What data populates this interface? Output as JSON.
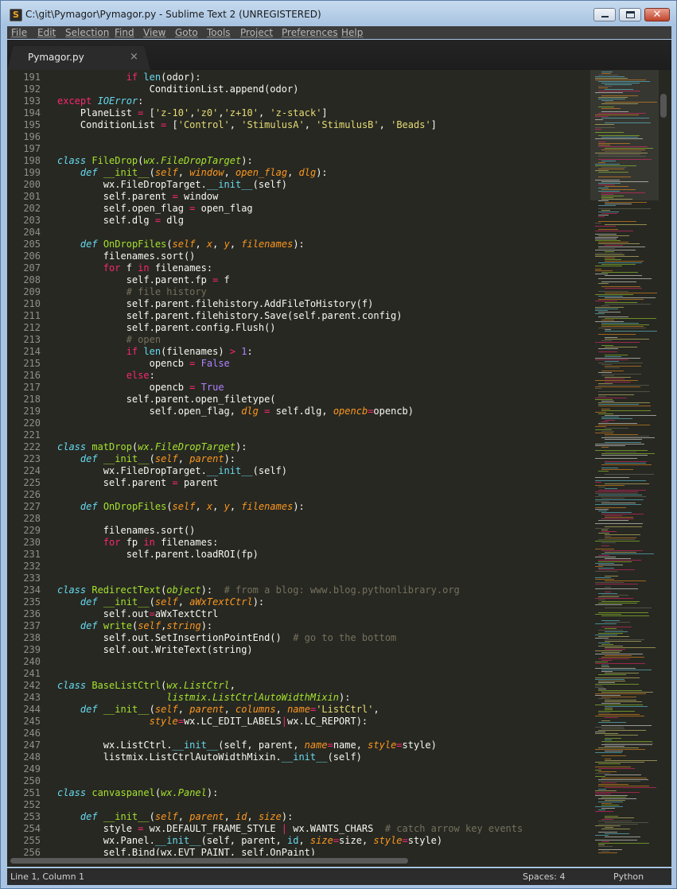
{
  "window": {
    "title": "C:\\git\\Pymagor\\Pymagor.py - Sublime Text 2 (UNREGISTERED)",
    "icon": "sublime-icon",
    "buttons": {
      "minimize": "minimize-icon",
      "maximize": "maximize-icon",
      "close": "close-icon"
    }
  },
  "menu": [
    "File",
    "Edit",
    "Selection",
    "Find",
    "View",
    "Goto",
    "Tools",
    "Project",
    "Preferences",
    "Help"
  ],
  "tab": {
    "label": "Pymagor.py",
    "close_glyph": "×"
  },
  "status": {
    "position": "Line 1, Column 1",
    "spaces": "Spaces: 4",
    "syntax": "Python"
  },
  "theme": {
    "background": "#272822",
    "foreground": "#f8f8f2",
    "keyword": "#f92672",
    "string": "#e6db74",
    "comment": "#75715e",
    "function": "#a6e22e",
    "builtin": "#66d9ef",
    "argument": "#fd971f",
    "number": "#ae81ff"
  },
  "editor": {
    "lines": [
      {
        "n": "191",
        "t": [
          [
            "            "
          ],
          [
            "if",
            "k"
          ],
          [
            " "
          ],
          [
            "len",
            "bi"
          ],
          [
            "(odor):"
          ]
        ]
      },
      {
        "n": "192",
        "t": [
          [
            "                ConditionList.append(odor)"
          ]
        ]
      },
      {
        "n": "193",
        "t": [
          [
            "except",
            "k"
          ],
          [
            " "
          ],
          [
            "IOError",
            "b"
          ],
          [
            ":"
          ]
        ]
      },
      {
        "n": "194",
        "t": [
          [
            "    PlaneList "
          ],
          [
            "=",
            "k"
          ],
          [
            " ["
          ],
          [
            "'z-10'",
            "s"
          ],
          [
            ","
          ],
          [
            "'z0'",
            "s"
          ],
          [
            ","
          ],
          [
            "'z+10'",
            "s"
          ],
          [
            ", "
          ],
          [
            "'z-stack'",
            "s"
          ],
          [
            "]"
          ]
        ]
      },
      {
        "n": "195",
        "t": [
          [
            "    ConditionList "
          ],
          [
            "=",
            "k"
          ],
          [
            " ["
          ],
          [
            "'Control'",
            "s"
          ],
          [
            ", "
          ],
          [
            "'StimulusA'",
            "s"
          ],
          [
            ", "
          ],
          [
            "'StimulusB'",
            "s"
          ],
          [
            ", "
          ],
          [
            "'Beads'",
            "s"
          ],
          [
            "]"
          ]
        ]
      },
      {
        "n": "196",
        "t": []
      },
      {
        "n": "197",
        "t": []
      },
      {
        "n": "198",
        "t": [
          [
            "class",
            "b"
          ],
          [
            " "
          ],
          [
            "FileDrop",
            "f"
          ],
          [
            "("
          ],
          [
            "wx.FileDropTarget",
            "i"
          ],
          [
            "):"
          ]
        ]
      },
      {
        "n": "199",
        "t": [
          [
            "    "
          ],
          [
            "def",
            "b"
          ],
          [
            " "
          ],
          [
            "__init__",
            "f"
          ],
          [
            "("
          ],
          [
            "self",
            "a"
          ],
          [
            ", "
          ],
          [
            "window",
            "a"
          ],
          [
            ", "
          ],
          [
            "open_flag",
            "a"
          ],
          [
            ", "
          ],
          [
            "dlg",
            "a"
          ],
          [
            "):"
          ]
        ]
      },
      {
        "n": "200",
        "t": [
          [
            "        wx.FileDropTarget."
          ],
          [
            "__init__",
            "bi"
          ],
          [
            "(self)"
          ]
        ]
      },
      {
        "n": "201",
        "t": [
          [
            "        self.parent "
          ],
          [
            "=",
            "k"
          ],
          [
            " window"
          ]
        ]
      },
      {
        "n": "202",
        "t": [
          [
            "        self.open_flag "
          ],
          [
            "=",
            "k"
          ],
          [
            " open_flag"
          ]
        ]
      },
      {
        "n": "203",
        "t": [
          [
            "        self.dlg "
          ],
          [
            "=",
            "k"
          ],
          [
            " dlg"
          ]
        ]
      },
      {
        "n": "204",
        "t": []
      },
      {
        "n": "205",
        "t": [
          [
            "    "
          ],
          [
            "def",
            "b"
          ],
          [
            " "
          ],
          [
            "OnDropFiles",
            "f"
          ],
          [
            "("
          ],
          [
            "self",
            "a"
          ],
          [
            ", "
          ],
          [
            "x",
            "a"
          ],
          [
            ", "
          ],
          [
            "y",
            "a"
          ],
          [
            ", "
          ],
          [
            "filenames",
            "a"
          ],
          [
            "):"
          ]
        ]
      },
      {
        "n": "206",
        "t": [
          [
            "        filenames.sort()"
          ]
        ]
      },
      {
        "n": "207",
        "t": [
          [
            "        "
          ],
          [
            "for",
            "k"
          ],
          [
            " f "
          ],
          [
            "in",
            "k"
          ],
          [
            " filenames:"
          ]
        ]
      },
      {
        "n": "208",
        "t": [
          [
            "            self.parent.fp "
          ],
          [
            "=",
            "k"
          ],
          [
            " f"
          ]
        ]
      },
      {
        "n": "209",
        "t": [
          [
            "            "
          ],
          [
            "# file history",
            "c"
          ]
        ]
      },
      {
        "n": "210",
        "t": [
          [
            "            self.parent.filehistory.AddFileToHistory(f)"
          ]
        ]
      },
      {
        "n": "211",
        "t": [
          [
            "            self.parent.filehistory.Save(self.parent.config)"
          ]
        ]
      },
      {
        "n": "212",
        "t": [
          [
            "            self.parent.config.Flush()"
          ]
        ]
      },
      {
        "n": "213",
        "t": [
          [
            "            "
          ],
          [
            "# open",
            "c"
          ]
        ]
      },
      {
        "n": "214",
        "t": [
          [
            "            "
          ],
          [
            "if",
            "k"
          ],
          [
            " "
          ],
          [
            "len",
            "bi"
          ],
          [
            "(filenames) "
          ],
          [
            ">",
            "k"
          ],
          [
            " "
          ],
          [
            "1",
            "n"
          ],
          [
            ":"
          ]
        ]
      },
      {
        "n": "215",
        "t": [
          [
            "                opencb "
          ],
          [
            "=",
            "k"
          ],
          [
            " "
          ],
          [
            "False",
            "n"
          ]
        ]
      },
      {
        "n": "216",
        "t": [
          [
            "            "
          ],
          [
            "else",
            "k"
          ],
          [
            ":"
          ]
        ]
      },
      {
        "n": "217",
        "t": [
          [
            "                opencb "
          ],
          [
            "=",
            "k"
          ],
          [
            " "
          ],
          [
            "True",
            "n"
          ]
        ]
      },
      {
        "n": "218",
        "t": [
          [
            "            self.parent.open_filetype("
          ]
        ]
      },
      {
        "n": "219",
        "t": [
          [
            "                self.open_flag, "
          ],
          [
            "dlg",
            "a"
          ],
          [
            " "
          ],
          [
            "=",
            "k"
          ],
          [
            " self.dlg, "
          ],
          [
            "opencb",
            "a"
          ],
          [
            "=",
            "k"
          ],
          [
            "opencb)"
          ]
        ]
      },
      {
        "n": "220",
        "t": []
      },
      {
        "n": "221",
        "t": []
      },
      {
        "n": "222",
        "t": [
          [
            "class",
            "b"
          ],
          [
            " "
          ],
          [
            "matDrop",
            "f"
          ],
          [
            "("
          ],
          [
            "wx.FileDropTarget",
            "i"
          ],
          [
            "):"
          ]
        ]
      },
      {
        "n": "223",
        "t": [
          [
            "    "
          ],
          [
            "def",
            "b"
          ],
          [
            " "
          ],
          [
            "__init__",
            "f"
          ],
          [
            "("
          ],
          [
            "self",
            "a"
          ],
          [
            ", "
          ],
          [
            "parent",
            "a"
          ],
          [
            "):"
          ]
        ]
      },
      {
        "n": "224",
        "t": [
          [
            "        wx.FileDropTarget."
          ],
          [
            "__init__",
            "bi"
          ],
          [
            "(self)"
          ]
        ]
      },
      {
        "n": "225",
        "t": [
          [
            "        self.parent "
          ],
          [
            "=",
            "k"
          ],
          [
            " parent"
          ]
        ]
      },
      {
        "n": "226",
        "t": []
      },
      {
        "n": "227",
        "t": [
          [
            "    "
          ],
          [
            "def",
            "b"
          ],
          [
            " "
          ],
          [
            "OnDropFiles",
            "f"
          ],
          [
            "("
          ],
          [
            "self",
            "a"
          ],
          [
            ", "
          ],
          [
            "x",
            "a"
          ],
          [
            ", "
          ],
          [
            "y",
            "a"
          ],
          [
            ", "
          ],
          [
            "filenames",
            "a"
          ],
          [
            "):"
          ]
        ]
      },
      {
        "n": "228",
        "t": []
      },
      {
        "n": "229",
        "t": [
          [
            "        filenames.sort()"
          ]
        ]
      },
      {
        "n": "230",
        "t": [
          [
            "        "
          ],
          [
            "for",
            "k"
          ],
          [
            " fp "
          ],
          [
            "in",
            "k"
          ],
          [
            " filenames:"
          ]
        ]
      },
      {
        "n": "231",
        "t": [
          [
            "            self.parent.loadROI(fp)"
          ]
        ]
      },
      {
        "n": "232",
        "t": []
      },
      {
        "n": "233",
        "t": []
      },
      {
        "n": "234",
        "t": [
          [
            "class",
            "b"
          ],
          [
            " "
          ],
          [
            "RedirectText",
            "f"
          ],
          [
            "("
          ],
          [
            "object",
            "i"
          ],
          [
            "):  "
          ],
          [
            "# from a blog: www.blog.pythonlibrary.org",
            "c"
          ]
        ]
      },
      {
        "n": "235",
        "t": [
          [
            "    "
          ],
          [
            "def",
            "b"
          ],
          [
            " "
          ],
          [
            "__init__",
            "f"
          ],
          [
            "("
          ],
          [
            "self",
            "a"
          ],
          [
            ", "
          ],
          [
            "aWxTextCtrl",
            "a"
          ],
          [
            "):"
          ]
        ]
      },
      {
        "n": "236",
        "t": [
          [
            "        self.out"
          ],
          [
            "=",
            "k"
          ],
          [
            "aWxTextCtrl"
          ]
        ]
      },
      {
        "n": "237",
        "t": [
          [
            "    "
          ],
          [
            "def",
            "b"
          ],
          [
            " "
          ],
          [
            "write",
            "f"
          ],
          [
            "("
          ],
          [
            "self",
            "a"
          ],
          [
            ","
          ],
          [
            "string",
            "a"
          ],
          [
            "):"
          ]
        ]
      },
      {
        "n": "238",
        "t": [
          [
            "        self.out.SetInsertionPointEnd()  "
          ],
          [
            "# go to the bottom",
            "c"
          ]
        ]
      },
      {
        "n": "239",
        "t": [
          [
            "        self.out.WriteText(string)"
          ]
        ]
      },
      {
        "n": "240",
        "t": []
      },
      {
        "n": "241",
        "t": []
      },
      {
        "n": "242",
        "t": [
          [
            "class",
            "b"
          ],
          [
            " "
          ],
          [
            "BaseListCtrl",
            "f"
          ],
          [
            "("
          ],
          [
            "wx.ListCtrl",
            "i"
          ],
          [
            ","
          ]
        ]
      },
      {
        "n": "243",
        "t": [
          [
            "                   "
          ],
          [
            "listmix.ListCtrlAutoWidthMixin",
            "i"
          ],
          [
            "):"
          ]
        ]
      },
      {
        "n": "244",
        "t": [
          [
            "    "
          ],
          [
            "def",
            "b"
          ],
          [
            " "
          ],
          [
            "__init__",
            "f"
          ],
          [
            "("
          ],
          [
            "self",
            "a"
          ],
          [
            ", "
          ],
          [
            "parent",
            "a"
          ],
          [
            ", "
          ],
          [
            "columns",
            "a"
          ],
          [
            ", "
          ],
          [
            "name",
            "a"
          ],
          [
            "=",
            "k"
          ],
          [
            "'ListCtrl'",
            "s"
          ],
          [
            ","
          ]
        ]
      },
      {
        "n": "245",
        "t": [
          [
            "                "
          ],
          [
            "style",
            "a"
          ],
          [
            "=",
            "k"
          ],
          [
            "wx.LC_EDIT_LABELS"
          ],
          [
            "|",
            "k"
          ],
          [
            "wx.LC_REPORT):"
          ]
        ]
      },
      {
        "n": "246",
        "t": []
      },
      {
        "n": "247",
        "t": [
          [
            "        wx.ListCtrl."
          ],
          [
            "__init__",
            "bi"
          ],
          [
            "(self, parent, "
          ],
          [
            "name",
            "a"
          ],
          [
            "=",
            "k"
          ],
          [
            "name, "
          ],
          [
            "style",
            "a"
          ],
          [
            "=",
            "k"
          ],
          [
            "style)"
          ]
        ]
      },
      {
        "n": "248",
        "t": [
          [
            "        listmix.ListCtrlAutoWidthMixin."
          ],
          [
            "__init__",
            "bi"
          ],
          [
            "(self)"
          ]
        ]
      },
      {
        "n": "249",
        "t": []
      },
      {
        "n": "250",
        "t": []
      },
      {
        "n": "251",
        "t": [
          [
            "class",
            "b"
          ],
          [
            " "
          ],
          [
            "canvaspanel",
            "f"
          ],
          [
            "("
          ],
          [
            "wx.Panel",
            "i"
          ],
          [
            "):"
          ]
        ]
      },
      {
        "n": "252",
        "t": []
      },
      {
        "n": "253",
        "t": [
          [
            "    "
          ],
          [
            "def",
            "b"
          ],
          [
            " "
          ],
          [
            "__init__",
            "f"
          ],
          [
            "("
          ],
          [
            "self",
            "a"
          ],
          [
            ", "
          ],
          [
            "parent",
            "a"
          ],
          [
            ", "
          ],
          [
            "id",
            "a"
          ],
          [
            ", "
          ],
          [
            "size",
            "a"
          ],
          [
            "):"
          ]
        ]
      },
      {
        "n": "254",
        "t": [
          [
            "        style "
          ],
          [
            "=",
            "k"
          ],
          [
            " wx.DEFAULT_FRAME_STYLE "
          ],
          [
            "|",
            "k"
          ],
          [
            " wx.WANTS_CHARS  "
          ],
          [
            "# catch arrow key events",
            "c"
          ]
        ]
      },
      {
        "n": "255",
        "t": [
          [
            "        wx.Panel."
          ],
          [
            "__init__",
            "bi"
          ],
          [
            "(self, parent, "
          ],
          [
            "id",
            "bi"
          ],
          [
            ", "
          ],
          [
            "size",
            "a"
          ],
          [
            "=",
            "k"
          ],
          [
            "size, "
          ],
          [
            "style",
            "a"
          ],
          [
            "=",
            "k"
          ],
          [
            "style)"
          ]
        ]
      },
      {
        "n": "256",
        "t": [
          [
            "        self.Bind(wx.EVT_PAINT, self.OnPaint)"
          ]
        ]
      }
    ]
  }
}
